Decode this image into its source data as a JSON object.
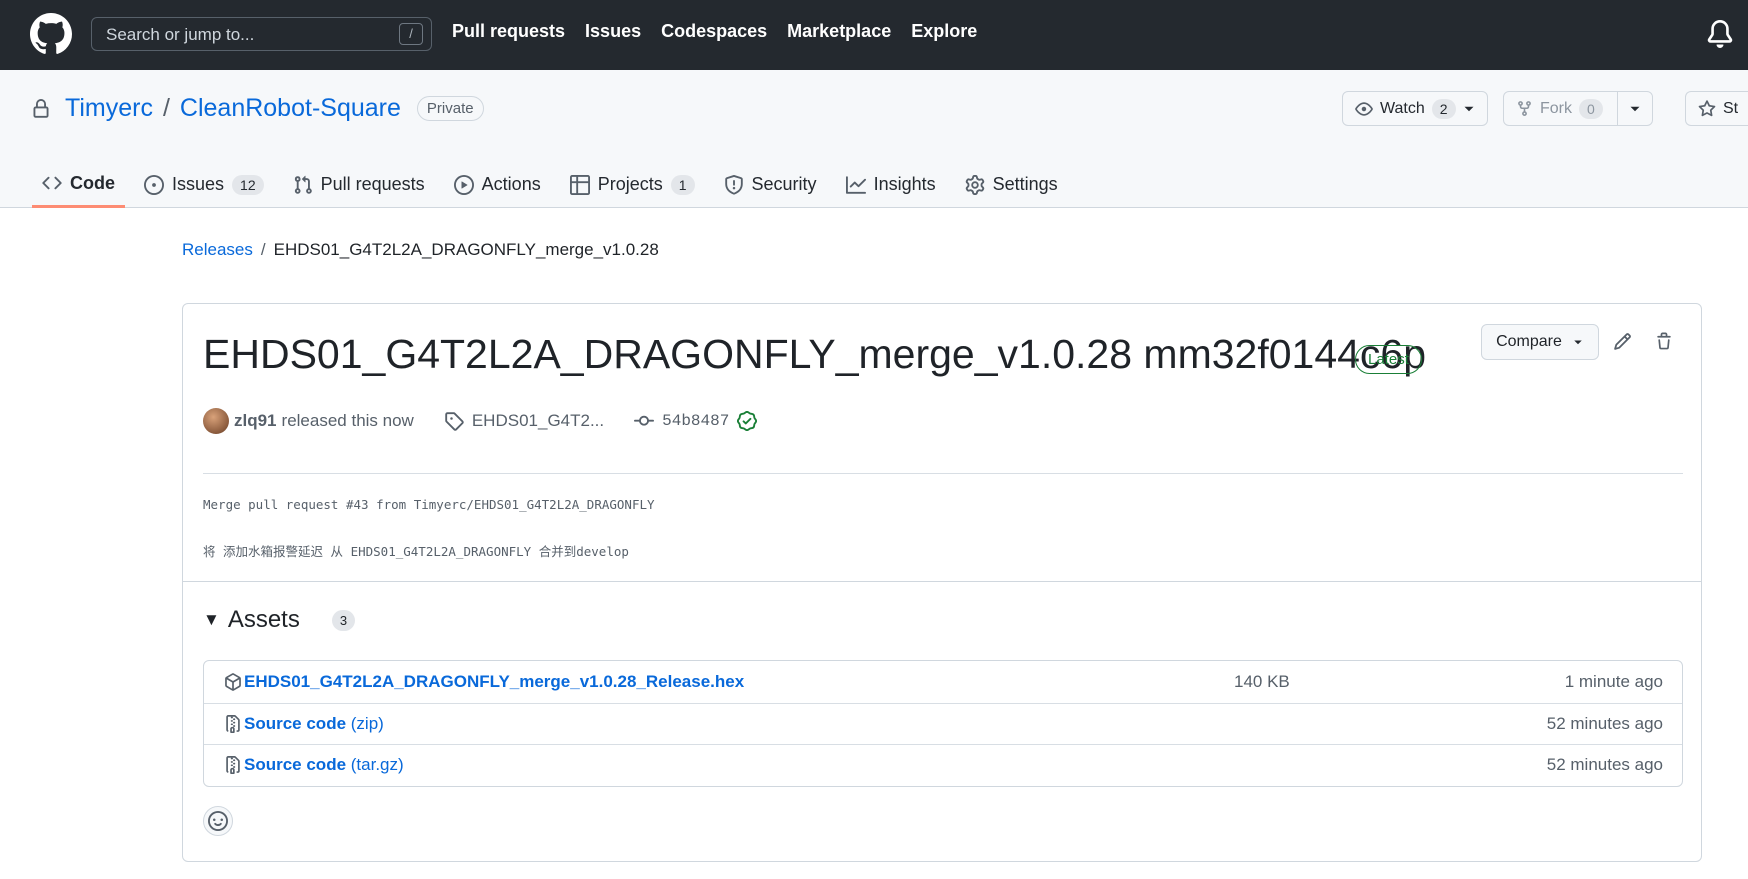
{
  "header": {
    "search_placeholder": "Search or jump to...",
    "search_shortcut": "/",
    "nav": [
      "Pull requests",
      "Issues",
      "Codespaces",
      "Marketplace",
      "Explore"
    ]
  },
  "repo": {
    "owner": "Timyerc",
    "separator": "/",
    "name": "CleanRobot-Square",
    "visibility": "Private",
    "watch_label": "Watch",
    "watch_count": "2",
    "fork_label": "Fork",
    "fork_count": "0",
    "star_label": "St"
  },
  "tabs": [
    {
      "label": "Code",
      "icon": "code-icon"
    },
    {
      "label": "Issues",
      "icon": "issue-icon",
      "count": "12"
    },
    {
      "label": "Pull requests",
      "icon": "pull-request-icon"
    },
    {
      "label": "Actions",
      "icon": "play-icon"
    },
    {
      "label": "Projects",
      "icon": "table-icon",
      "count": "1"
    },
    {
      "label": "Security",
      "icon": "shield-icon"
    },
    {
      "label": "Insights",
      "icon": "graph-icon"
    },
    {
      "label": "Settings",
      "icon": "gear-icon"
    }
  ],
  "breadcrumb": {
    "root": "Releases",
    "separator": "/",
    "current": "EHDS01_G4T2L2A_DRAGONFLY_merge_v1.0.28"
  },
  "release": {
    "title": "EHDS01_G4T2L2A_DRAGONFLY_merge_v1.0.28 mm32f0144c6p",
    "badge": "Latest",
    "compare_label": "Compare",
    "author": "zlq91",
    "released_text": "released this now",
    "tag": "EHDS01_G4T2...",
    "commit": "54b8487",
    "body_line1": "Merge pull request #43 from Timyerc/EHDS01_G4T2L2A_DRAGONFLY",
    "body_line2": "将 添加水箱报警延迟 从 EHDS01_G4T2L2A_DRAGONFLY 合并到develop"
  },
  "assets": {
    "label": "Assets",
    "count": "3",
    "items": [
      {
        "name": "EHDS01_G4T2L2A_DRAGONFLY_merge_v1.0.28_Release.hex",
        "suffix": "",
        "size": "140 KB",
        "time": "1 minute ago",
        "icon": "package-icon"
      },
      {
        "name": "Source code",
        "suffix": " (zip)",
        "size": "",
        "time": "52 minutes ago",
        "icon": "file-zip-icon"
      },
      {
        "name": "Source code",
        "suffix": " (tar.gz)",
        "size": "",
        "time": "52 minutes ago",
        "icon": "file-zip-icon"
      }
    ]
  },
  "colors": {
    "header_bg": "#24292f",
    "link": "#0969da",
    "latest_green": "#1a7f37",
    "active_tab_underline": "#fd8c73"
  }
}
